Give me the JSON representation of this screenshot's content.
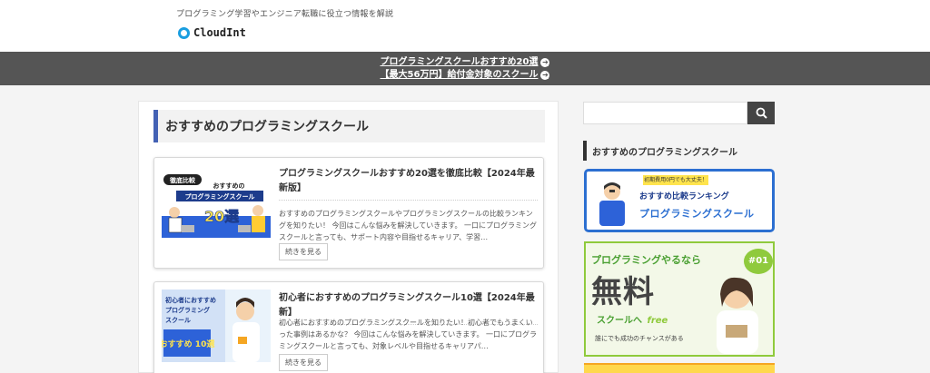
{
  "header": {
    "tagline": "プログラミング学習やエンジニア転職に役立つ情報を解説",
    "logo_text": "CloudInt"
  },
  "notice_bar": {
    "links": [
      "プログラミングスクールおすすめ20選",
      "【最大56万円】給付金対象のスクール"
    ]
  },
  "main": {
    "heading": "おすすめのプログラミングスクール",
    "posts": [
      {
        "title": "プログラミングスクールおすすめ20選を徹底比較【2024年最新版】",
        "excerpt": "おすすめのプログラミングスクールやプログラミングスクールの比較ランキングを知りたい！ 今回はこんな悩みを解決していきます。 一口にプログラミングスクールと言っても、サポート内容や目指せるキャリア、学習…",
        "more_label": "続きを見る",
        "thumb": {
          "badge": "徹底比較",
          "line1": "おすすめの",
          "line2": "プログラミングスクール",
          "big": "20選"
        }
      },
      {
        "title": "初心者におすすめのプログラミングスクール10選【2024年最新】",
        "excerpt": "初心者におすすめのプログラミングスクールを知りたい！初心者でもうまくいった事例はあるかな？ 今回はこんな悩みを解決していきます。 一口にプログラミングスクールと言っても、対象レベルや目指せるキャリアパ…",
        "more_label": "続きを見る",
        "thumb": {
          "line1": "初心者におすすめ",
          "line2": "プログラミング",
          "line3": "スクール",
          "big": "おすすめ 10選"
        }
      }
    ]
  },
  "sidebar": {
    "search_placeholder": "",
    "widget_title": "おすすめのプログラミングスクール",
    "banner1": {
      "ribbon": "初期費用0円でも大丈夫！",
      "line1": "おすすめ比較ランキング",
      "line2": "プログラミングスクール"
    },
    "banner2": {
      "top": "プログラミングやるなら",
      "big": "無料",
      "school": "スクールへ",
      "free": "free",
      "chance": "誰にでも成功のチャンスがある",
      "no": "#01"
    }
  },
  "colors": {
    "accent_blue": "#4361b4",
    "notice_bg": "#555555",
    "logo_blue": "#1a9ee0",
    "green": "#8fca3c"
  },
  "icons": [
    "logo-ring-icon",
    "arrow-circle-icon",
    "search-icon"
  ]
}
